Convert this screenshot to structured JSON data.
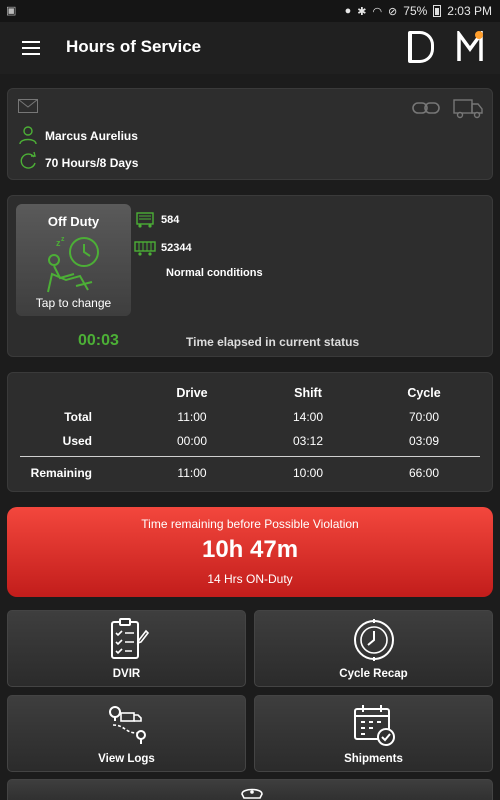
{
  "statusbar": {
    "battery": "75%",
    "time": "2:03 PM"
  },
  "appbar": {
    "title": "Hours of Service",
    "badge_d": "D",
    "badge_m": "M"
  },
  "driver": {
    "name": "Marcus Aurelius",
    "cycle": "70 Hours/8 Days"
  },
  "status": {
    "current": "Off Duty",
    "tap_hint": "Tap to change",
    "truck_number": "584",
    "trailer_number": "52344",
    "conditions": "Normal conditions",
    "elapsed": "00:03",
    "elapsed_label": "Time elapsed in current status"
  },
  "hours_table": {
    "columns": [
      "Drive",
      "Shift",
      "Cycle"
    ],
    "rows": [
      {
        "label": "Total",
        "values": [
          "11:00",
          "14:00",
          "70:00"
        ]
      },
      {
        "label": "Used",
        "values": [
          "00:00",
          "03:12",
          "03:09"
        ]
      },
      {
        "label": "Remaining",
        "values": [
          "11:00",
          "10:00",
          "66:00"
        ]
      }
    ]
  },
  "violation": {
    "title": "Time remaining before Possible Violation",
    "time": "10h 47m",
    "rule": "14 Hrs ON-Duty"
  },
  "tiles": [
    {
      "label": "DVIR",
      "icon": "checklist-icon"
    },
    {
      "label": "Cycle Recap",
      "icon": "clock-recap-icon"
    },
    {
      "label": "View Logs",
      "icon": "route-logs-icon"
    },
    {
      "label": "Shipments",
      "icon": "calendar-check-icon"
    }
  ],
  "colors": {
    "accent_green": "#4caf36",
    "violation_red": "#e3302b",
    "notification_dot": "#ff9e2c"
  }
}
